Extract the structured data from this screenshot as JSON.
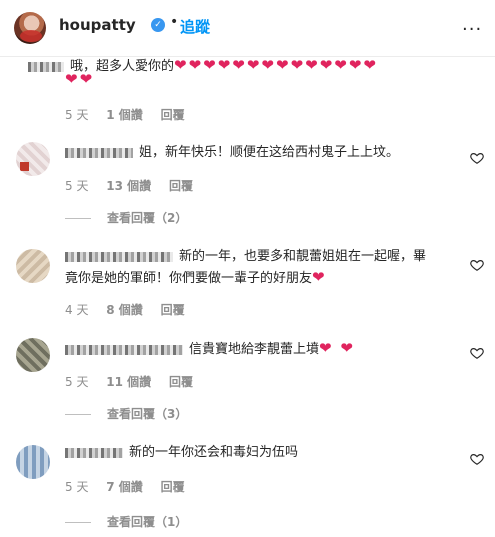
{
  "header": {
    "username": "houpatty",
    "verified_icon": "verified-badge-icon",
    "separator": "•",
    "follow_label": "追蹤",
    "more_label": "..."
  },
  "comments": [
    {
      "text": "哦，超多人愛你的",
      "hearts": "❤❤❤❤❤❤❤❤❤❤❤❤❤❤",
      "hearts2": "❤❤",
      "time": "5 天",
      "likes": "1 個讚",
      "reply": "回覆"
    },
    {
      "text": "姐，新年快乐！顺便在这给西村鬼子上上坟。",
      "time": "5 天",
      "likes": "13 個讚",
      "reply": "回覆",
      "view_replies": "查看回覆（2）"
    },
    {
      "text": "新的一年，也要多和靚蕾姐姐在一起喔，畢",
      "text2": "竟你是她的軍師！你們要做一輩子的好朋友",
      "hearts": "❤",
      "time": "4 天",
      "likes": "8 個讚",
      "reply": "回覆"
    },
    {
      "text": "信貴寶地給李靚蕾上墳",
      "hearts": "❤ ❤",
      "time": "5 天",
      "likes": "11 個讚",
      "reply": "回覆",
      "view_replies": "查看回覆（3）"
    },
    {
      "text": "新的一年你还会和毒妇为伍吗",
      "time": "5 天",
      "likes": "7 個讚",
      "reply": "回覆",
      "view_replies": "查看回覆（1）"
    }
  ],
  "colors": {
    "accent": "#0095f6",
    "heart": "#e0245e",
    "muted": "#8e8e8e",
    "text": "#262626"
  }
}
